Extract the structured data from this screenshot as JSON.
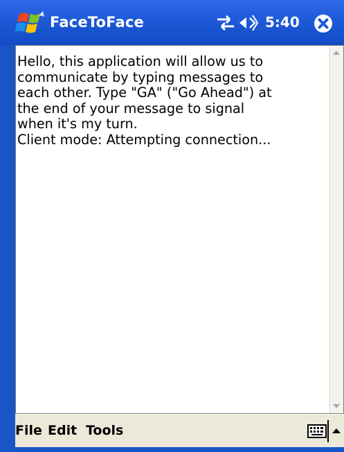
{
  "titlebar": {
    "app_title": "FaceToFace",
    "clock": "5:40",
    "icons": [
      "windows-start-flag-icon",
      "connectivity-icon",
      "volume-icon",
      "close-icon"
    ]
  },
  "content": {
    "message": "Hello, this application will allow us to\ncommunicate by typing messages to\neach other. Type \"GA\" (\"Go Ahead\") at\nthe end of your message to signal\nwhen it's my turn.\nClient mode: Attempting connection..."
  },
  "menubar": {
    "file": "File",
    "edit": "Edit",
    "tools": "Tools",
    "icons": [
      "keyboard-icon",
      "sip-arrow-up-icon"
    ]
  },
  "colors": {
    "titlebar": "#1e5ad8",
    "menubar": "#ece9d8",
    "content_bg": "#ffffff"
  }
}
